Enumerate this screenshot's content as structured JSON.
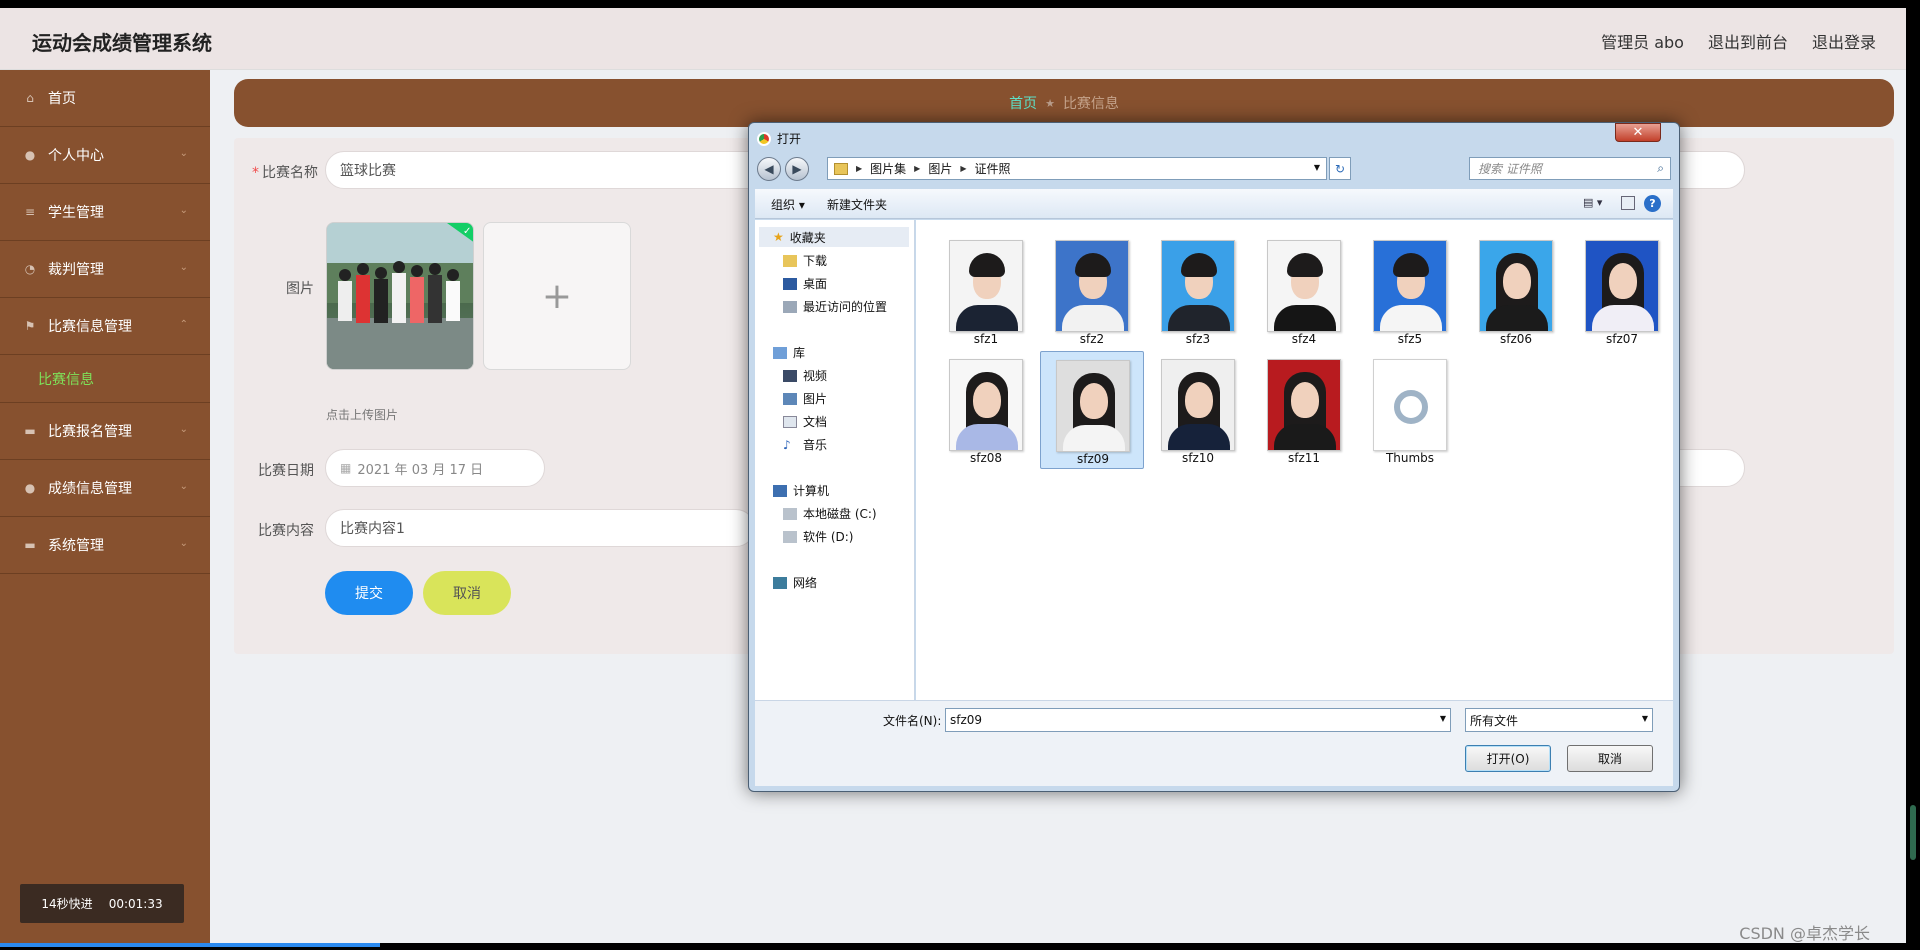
{
  "header": {
    "title": "运动会成绩管理系统",
    "user": "管理员 abo",
    "front_link": "退出到前台",
    "logout_link": "退出登录"
  },
  "sidebar": {
    "items": [
      {
        "label": "首页",
        "icon": "home-icon"
      },
      {
        "label": "个人中心",
        "icon": "user-icon"
      },
      {
        "label": "学生管理",
        "icon": "list-icon"
      },
      {
        "label": "裁判管理",
        "icon": "compass-icon"
      },
      {
        "label": "比赛信息管理",
        "icon": "flag-icon",
        "expanded": true
      },
      {
        "label": "比赛报名管理",
        "icon": "monitor-icon"
      },
      {
        "label": "成绩信息管理",
        "icon": "user-icon"
      },
      {
        "label": "系统管理",
        "icon": "monitor-icon"
      }
    ],
    "sub_item": "比赛信息",
    "timer": {
      "label": "14秒快进",
      "time": "00:01:33"
    }
  },
  "breadcrumb": {
    "home": "首页",
    "current": "比赛信息"
  },
  "form": {
    "name_label": "比赛名称",
    "name_value": "篮球比赛",
    "image_label": "图片",
    "upload_hint": "点击上传图片",
    "date_label": "比赛日期",
    "date_value": "2021 年 03 月 17 日",
    "content_label": "比赛内容",
    "content_value": "比赛内容1",
    "submit": "提交",
    "cancel": "取消"
  },
  "dialog": {
    "title": "打开",
    "close": "✕",
    "path": [
      "图片集",
      "图片",
      "证件照"
    ],
    "search_placeholder": "搜索 证件照",
    "toolbar": {
      "organize": "组织 ▾",
      "new_folder": "新建文件夹"
    },
    "nav": {
      "favorites": "收藏夹",
      "downloads": "下载",
      "desktop": "桌面",
      "recent": "最近访问的位置",
      "libraries": "库",
      "videos": "视频",
      "pictures": "图片",
      "documents": "文档",
      "music": "音乐",
      "computer": "计算机",
      "drive_c": "本地磁盘 (C:)",
      "drive_d": "软件 (D:)",
      "network": "网络"
    },
    "files": [
      {
        "name": "sfz1",
        "bg": "#f4f4f4",
        "body": "#1b2333",
        "hair": "short"
      },
      {
        "name": "sfz2",
        "bg": "#3d74c9",
        "body": "#f2f2f2",
        "hair": "short"
      },
      {
        "name": "sfz3",
        "bg": "#3aa0e8",
        "body": "#20242c",
        "hair": "short"
      },
      {
        "name": "sfz4",
        "bg": "#f5f5f5",
        "body": "#151515",
        "hair": "short"
      },
      {
        "name": "sfz5",
        "bg": "#2870d8",
        "body": "#f5f5f5",
        "hair": "short"
      },
      {
        "name": "sfz06",
        "bg": "#3aa6ea",
        "body": "#1b1b1b",
        "hair": "long"
      },
      {
        "name": "sfz07",
        "bg": "#1f54c4",
        "body": "#f0eef6",
        "hair": "long"
      },
      {
        "name": "sfz08",
        "bg": "#f7f7f7",
        "body": "#a9b8e6",
        "hair": "long"
      },
      {
        "name": "sfz09",
        "bg": "#dedede",
        "body": "#f4f4f4",
        "hair": "long",
        "selected": true
      },
      {
        "name": "sfz10",
        "bg": "#efefef",
        "body": "#16223a",
        "hair": "long"
      },
      {
        "name": "sfz11",
        "bg": "#b81b1f",
        "body": "#1a1a1a",
        "hair": "long"
      },
      {
        "name": "Thumbs",
        "bg": "#ffffff",
        "body": "",
        "hair": "none",
        "system": true
      }
    ],
    "filename_label": "文件名(N):",
    "filename_value": "sfz09",
    "filter": "所有文件",
    "open_button": "打开(O)",
    "cancel_button": "取消"
  },
  "watermark": "CSDN @卓杰学长",
  "colors": {
    "sidebar": "#87512f",
    "accent_green": "#7ee35a",
    "submit": "#1f8cf0",
    "cancel": "#d9e45a"
  }
}
